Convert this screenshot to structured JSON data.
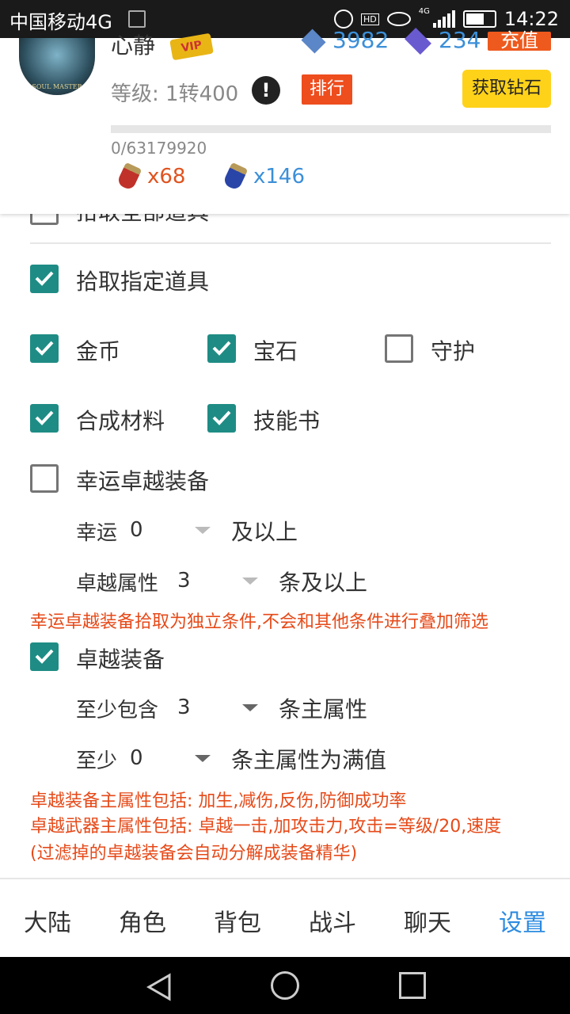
{
  "status_bar": {
    "carrier": "中国移动4G",
    "hd_label": "HD",
    "network_label": "4G",
    "time": "14:22"
  },
  "profile": {
    "username": "心静",
    "vip_label": "VIP",
    "currency1": "3982",
    "currency2": "234",
    "recharge_label": "充值",
    "level_text": "等级: 1转400",
    "rank_label": "排行",
    "get_diamonds_label": "获取钻石",
    "exp_text": "0/63179920",
    "exp_progress": 0,
    "red_potion_count": "x68",
    "blue_potion_count": "x146"
  },
  "settings": {
    "pickup_all_label": "拾取全部道具",
    "pickup_specific_label": "拾取指定道具",
    "items": {
      "gold": {
        "label": "金币",
        "checked": true
      },
      "gem": {
        "label": "宝石",
        "checked": true
      },
      "guard": {
        "label": "守护",
        "checked": false
      },
      "material": {
        "label": "合成材料",
        "checked": true
      },
      "skillbook": {
        "label": "技能书",
        "checked": true
      }
    },
    "lucky_excellent": {
      "label": "幸运卓越装备",
      "checked": false,
      "luck_prefix": "幸运",
      "luck_value": "0",
      "luck_suffix": "及以上",
      "attr_prefix": "卓越属性",
      "attr_value": "3",
      "attr_suffix": "条及以上",
      "note": "幸运卓越装备拾取为独立条件,不会和其他条件进行叠加筛选"
    },
    "excellent": {
      "label": "卓越装备",
      "checked": true,
      "min_main_prefix": "至少包含",
      "min_main_value": "3",
      "min_main_suffix": "条主属性",
      "min_full_prefix": "至少",
      "min_full_value": "0",
      "min_full_suffix": "条主属性为满值",
      "note1": "卓越装备主属性包括: 加生,减伤,反伤,防御成功率",
      "note2": "卓越武器主属性包括: 卓越一击,加攻击力,攻击=等级/20,速度",
      "note3": "(过滤掉的卓越装备会自动分解成装备精华)"
    }
  },
  "tabs": [
    "大陆",
    "角色",
    "背包",
    "战斗",
    "聊天",
    "设置"
  ],
  "active_tab": "设置",
  "colors": {
    "accent": "#1e8c84",
    "active_tab": "#2d8be0",
    "warning_text": "#e64a19",
    "rank_button": "#ee4d1e",
    "diamond_button": "#ffd21a"
  }
}
